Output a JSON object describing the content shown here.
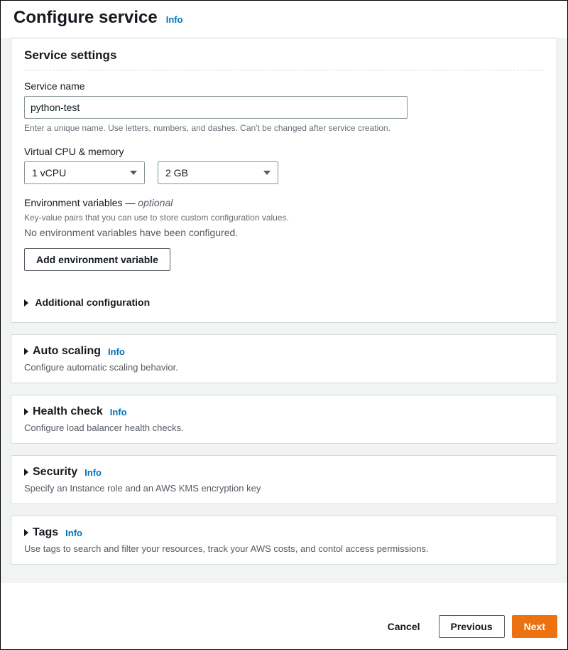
{
  "header": {
    "title": "Configure service",
    "info": "Info"
  },
  "service_settings": {
    "panel_title": "Service settings",
    "service_name": {
      "label": "Service name",
      "value": "python-test",
      "help": "Enter a unique name. Use letters, numbers, and dashes. Can't be changed after service creation."
    },
    "vcpu_memory": {
      "label": "Virtual CPU & memory",
      "vcpu": "1 vCPU",
      "memory": "2 GB"
    },
    "env_vars": {
      "label": "Environment variables",
      "optional": "optional",
      "help": "Key-value pairs that you can use to store custom configuration values.",
      "empty": "No environment variables have been configured.",
      "add_button": "Add environment variable"
    },
    "additional_config": "Additional configuration"
  },
  "auto_scaling": {
    "title": "Auto scaling",
    "info": "Info",
    "desc": "Configure automatic scaling behavior."
  },
  "health_check": {
    "title": "Health check",
    "info": "Info",
    "desc": "Configure load balancer health checks."
  },
  "security": {
    "title": "Security",
    "info": "Info",
    "desc": "Specify an Instance role and an AWS KMS encryption key"
  },
  "tags": {
    "title": "Tags",
    "info": "Info",
    "desc": "Use tags to search and filter your resources, track your AWS costs, and contol access permissions."
  },
  "footer": {
    "cancel": "Cancel",
    "previous": "Previous",
    "next": "Next"
  }
}
